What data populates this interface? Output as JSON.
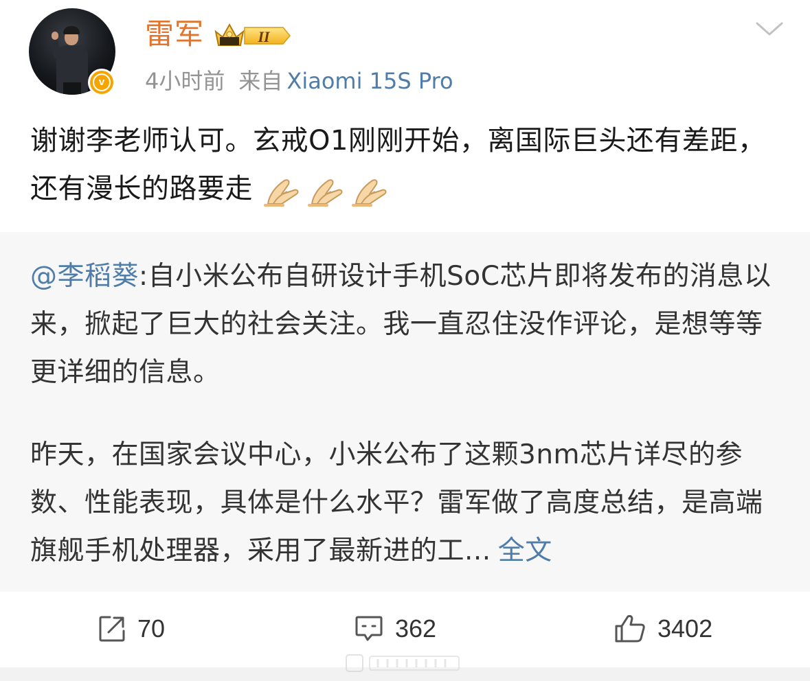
{
  "post": {
    "username": "雷军",
    "vip_level": "II",
    "verify_mark": "v",
    "time": "4小时前",
    "source_prefix": "来自",
    "source_device": "Xiaomi 15S Pro",
    "text": "谢谢李老师认可。玄戒O1刚刚开始，离国际巨头还有差距，还有漫长的路要走",
    "emojis": [
      "pray-emoji",
      "pray-emoji",
      "pray-emoji"
    ],
    "icons": {
      "verify": "verified-v-icon",
      "vip": "crown-vip-badge-icon",
      "more": "chevron-down-icon"
    }
  },
  "repost": {
    "mention": "@李稻葵",
    "para1": ":自小米公布自研设计手机SoC芯片即将发布的消息以来，掀起了巨大的社会关注。我一直忍住没作评论，是想等等更详细的信息。",
    "para2": "昨天，在国家会议中心，小米公布了这颗3nm芯片详尽的参数、性能表现，具体是什么水平？雷军做了高度总结，是高端旗舰手机处理器，采用了最新进的工...",
    "full_text_link": "全文"
  },
  "actions": {
    "repost_count": "70",
    "comment_count": "362",
    "like_count": "3402",
    "icons": {
      "repost": "share-arrow-icon",
      "comment": "comment-bubble-icon",
      "like": "thumbs-up-icon"
    }
  },
  "colors": {
    "username": "#e3742b",
    "link": "#4f7ca8",
    "meta": "#939393",
    "repost_bg": "#f7f7f7",
    "verify_badge": "#f6a400"
  }
}
